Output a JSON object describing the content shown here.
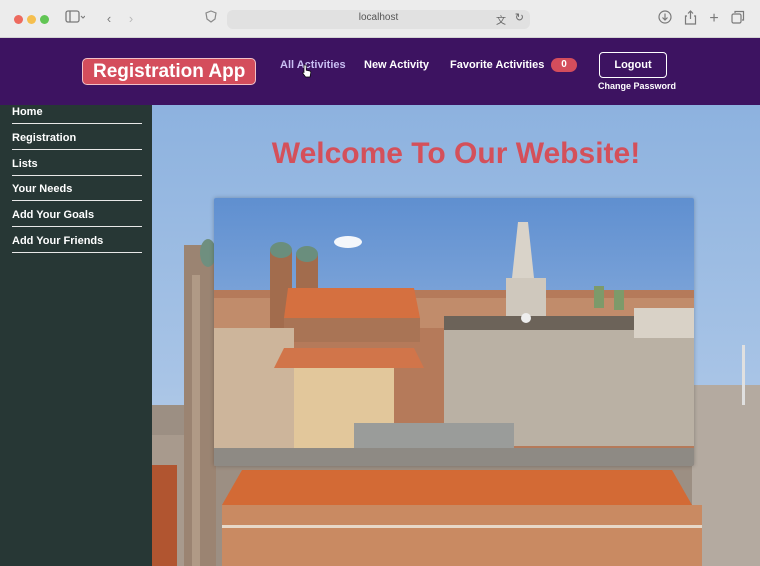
{
  "browser": {
    "url": "localhost"
  },
  "app": {
    "brand": "Registration App"
  },
  "nav": {
    "all_activities": "All Activities",
    "new_activity": "New Activity",
    "favorite_activities": "Favorite Activities",
    "favorite_count": "0",
    "logout": "Logout",
    "change_password": "Change Password"
  },
  "sidebar": {
    "items": [
      {
        "label": "Home"
      },
      {
        "label": "Registration"
      },
      {
        "label": "Lists"
      },
      {
        "label": "Your Needs"
      },
      {
        "label": "Add Your Goals"
      },
      {
        "label": "Add Your Friends"
      }
    ]
  },
  "main": {
    "welcome": "Welcome To Our Website!"
  },
  "colors": {
    "header_bg": "#3d1361",
    "brand_bg": "#d44d5c",
    "sidebar_bg": "#273735",
    "welcome_text": "#d4505a",
    "active_nav": "#c9bff3"
  }
}
